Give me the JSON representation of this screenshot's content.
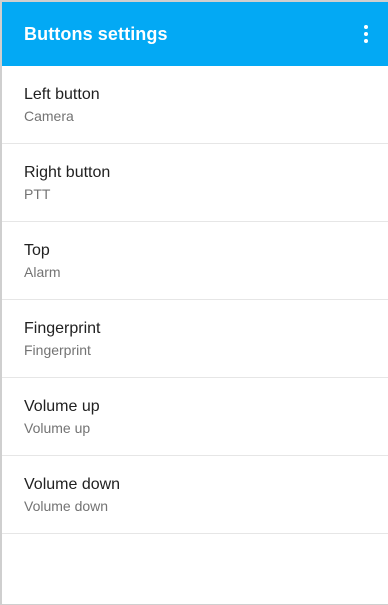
{
  "appbar": {
    "title": "Buttons settings",
    "menu_icon": "more-vert-icon",
    "background_color": "#03a9f4"
  },
  "settings": {
    "items": [
      {
        "title": "Left button",
        "summary": "Camera"
      },
      {
        "title": "Right button",
        "summary": "PTT"
      },
      {
        "title": "Top",
        "summary": "Alarm"
      },
      {
        "title": "Fingerprint",
        "summary": "Fingerprint"
      },
      {
        "title": "Volume up",
        "summary": "Volume up"
      },
      {
        "title": "Volume down",
        "summary": "Volume down"
      }
    ]
  }
}
